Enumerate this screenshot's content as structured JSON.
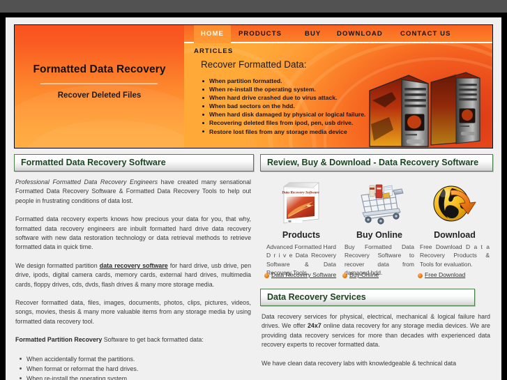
{
  "banner": {
    "title": "Formatted Data Recovery",
    "subtitle": "Recover Deleted Files",
    "nav": [
      {
        "label": "HOME",
        "active": true
      },
      {
        "label": "PRODUCTS",
        "active": false
      },
      {
        "label": "BUY",
        "active": false
      },
      {
        "label": "DOWNLOAD",
        "active": false
      },
      {
        "label": "CONTACT US",
        "active": false
      }
    ],
    "articles_label": "ARTICLES",
    "articles_heading": "Recover Formatted Data:",
    "articles_bullets": [
      "When partition formatted.",
      "When re-install the operating system.",
      "When hard drive crashed due to virus attack.",
      "When bad sectors on the hdd.",
      "When hard disk damaged by physical or logical failure.",
      "Recovering deleted files from ipod, pen, usb drive.",
      "Restore lost files from any storage media device"
    ]
  },
  "left": {
    "heading": "Formatted Data Recovery Software",
    "para1_italic": "Professional Formatted Data Recovery Engineers",
    "para1_rest": " have created many sensational Formatted Data Recovery Software & Formatted Data Recovery Tools to help out people in frustrating conditions of data lost.",
    "para2": "Formatted data recovery experts knows how precious your data for you, that why, formatted data recovery engineers are inbuilt formatted hard drive data recovery software with new data restoration technology or data retrieval methods to retrieve formatted data in quick time.",
    "para3_pre": "We design formatted partition ",
    "para3_link": "data recovery software",
    "para3_post": " for hard drive, usb drive, pen drive, ipods, digital camera cards, memory cards, external hard drives, multimedia cards, floppy drives, cds, dvds, flash drives & many more storage media.",
    "para4": "Recover formatted data, files, images, documents, photos, clips, pictures, videos, songs, movies, thesis & many more valuable items from any storage media by using formatted data recovery tool.",
    "para5_bold": "Formatted Partition Recovery",
    "para5_rest": " Software to get back formatted data:",
    "bullets": [
      "When accidentally format the partitions.",
      "When format or reformat the hard drives.",
      "When re-install the operating system."
    ]
  },
  "right": {
    "heading": "Review, Buy & Download - Data Recovery Software",
    "products": [
      {
        "icon": "software-box-icon",
        "title": "Products",
        "desc": "Advanced Formatted Hard D r i v e Data Recovery Software & Data Recovery Tools.",
        "link": "Data Recovery Software"
      },
      {
        "icon": "shopping-cart-icon",
        "title": "Buy Online",
        "desc": "Buy Formatted Data Recovery Software to recover data from damaged hdd.",
        "link": "Buy Online"
      },
      {
        "icon": "globe-download-icon",
        "title": "Download",
        "desc": "Free Download D a t a Recovery Products & Tools for evaluation.",
        "link": "Free Download"
      }
    ],
    "services_heading": "Data Recovery Services",
    "services_para1_a": "Data recovery services for physical, electrical, mechanical & logical failure hard drives. We offer ",
    "services_para1_b": "24x7",
    "services_para1_c": " online data recovery for any storage media devices. We are providing data recovery services for more than decades with experienced data recovery experts to recover formatted data.",
    "services_para2": "We have clean data recovery labs with knowledgeable & technical data"
  },
  "colors": {
    "banner_top": "#f9521f",
    "banner_bottom": "#ffa838",
    "nav_active": "#ff9a34",
    "heading_green": "#1d4423",
    "border_green": "#4b7f4b",
    "page_bg": "#f0f0f0",
    "chrome_gray": "#525252"
  }
}
